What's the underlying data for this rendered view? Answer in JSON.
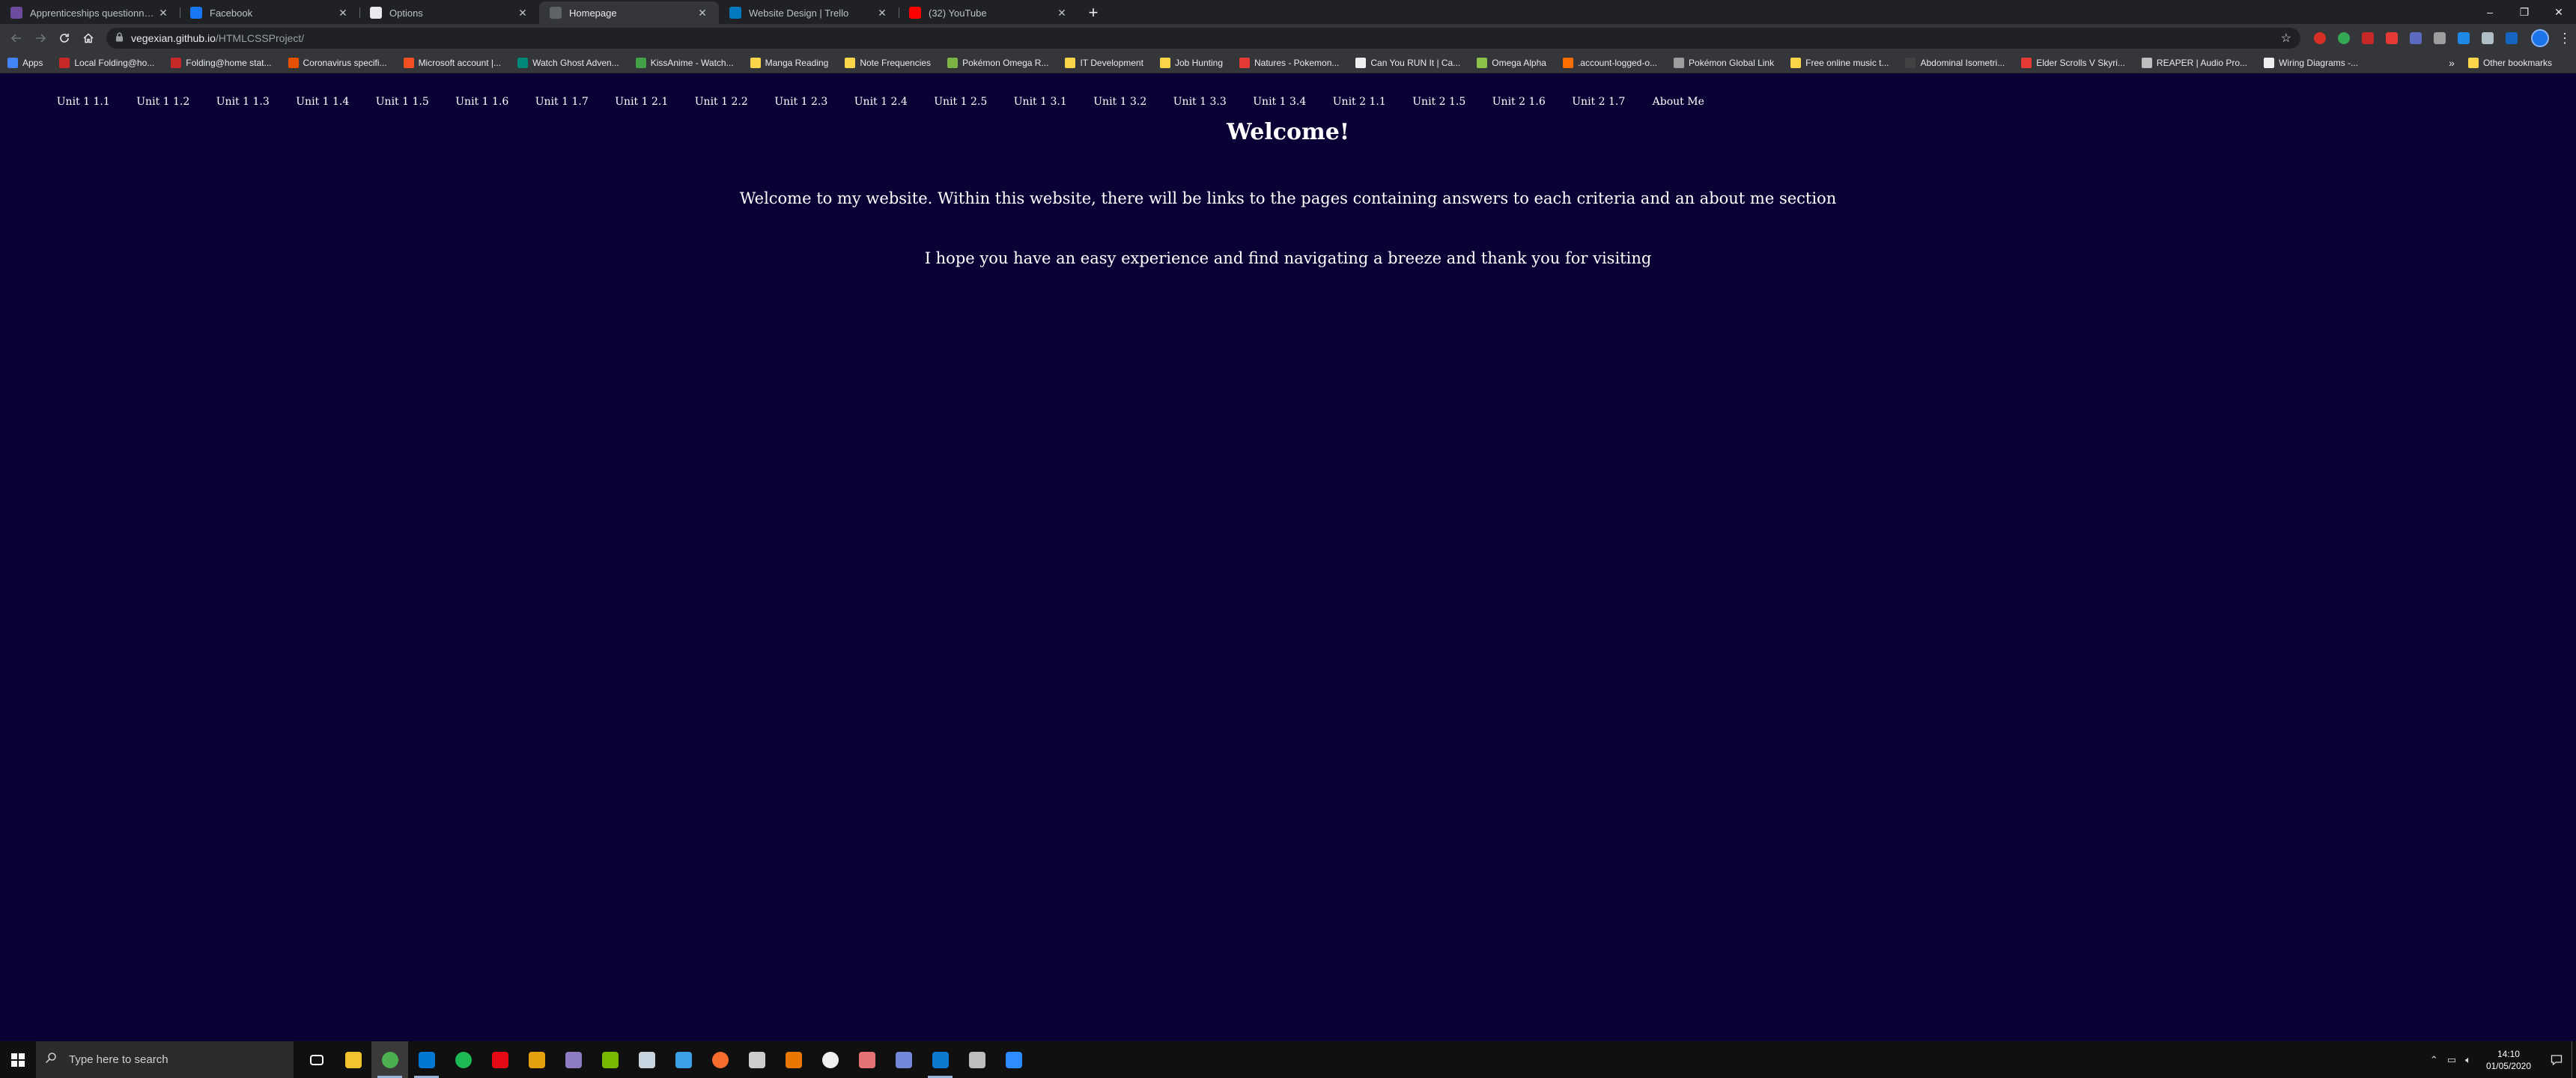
{
  "browser": {
    "tabs": [
      {
        "title": "Apprenticeships questionnaire",
        "icon": "forms-icon",
        "color": "#6d4c9f",
        "active": false
      },
      {
        "title": "Facebook",
        "icon": "facebook-icon",
        "color": "#1877f2",
        "active": false
      },
      {
        "title": "Options",
        "icon": "github-icon",
        "color": "#e8eaed",
        "active": false
      },
      {
        "title": "Homepage",
        "icon": "page-icon",
        "color": "#5f6368",
        "active": true
      },
      {
        "title": "Website Design | Trello",
        "icon": "trello-icon",
        "color": "#0079bf",
        "active": false
      },
      {
        "title": "(32) YouTube",
        "icon": "youtube-icon",
        "color": "#ff0000",
        "active": false
      }
    ],
    "new_tab_glyph": "+",
    "window_controls": {
      "minimize": "–",
      "restore": "❐",
      "close": "✕"
    },
    "url_host": "vegexian.github.io",
    "url_path": "/HTMLCSSProject/",
    "bookmarks": [
      {
        "label": "Apps",
        "color": "#4285f4"
      },
      {
        "label": "Local Folding@ho...",
        "color": "#c62828"
      },
      {
        "label": "Folding@home stat...",
        "color": "#c62828"
      },
      {
        "label": "Coronavirus specifi...",
        "color": "#e65100"
      },
      {
        "label": "Microsoft account |...",
        "color": "#f25022"
      },
      {
        "label": "Watch Ghost Adven...",
        "color": "#00897b"
      },
      {
        "label": "KissAnime - Watch...",
        "color": "#43a047"
      },
      {
        "label": "Manga Reading",
        "color": "#f9d549"
      },
      {
        "label": "Note Frequencies",
        "color": "#f9d549"
      },
      {
        "label": "Pokémon Omega R...",
        "color": "#7cb342"
      },
      {
        "label": "IT Development",
        "color": "#f9d549"
      },
      {
        "label": "Job Hunting",
        "color": "#f9d549"
      },
      {
        "label": "Natures - Pokemon...",
        "color": "#e53935"
      },
      {
        "label": "Can You RUN It | Ca...",
        "color": "#eeeeee"
      },
      {
        "label": "Omega Alpha",
        "color": "#8bc34a"
      },
      {
        "label": ".account-logged-o...",
        "color": "#ff6f00"
      },
      {
        "label": "Pokémon Global Link",
        "color": "#9e9e9e"
      },
      {
        "label": "Free online music t...",
        "color": "#f9d549"
      },
      {
        "label": "Abdominal Isometri...",
        "color": "#424242"
      },
      {
        "label": "Elder Scrolls V Skyri...",
        "color": "#e53935"
      },
      {
        "label": "REAPER | Audio Pro...",
        "color": "#bdbdbd"
      },
      {
        "label": "Wiring Diagrams -...",
        "color": "#eeeeee"
      }
    ],
    "bookmarks_more": "»",
    "other_bookmarks": "Other bookmarks"
  },
  "site": {
    "nav": [
      "Unit 1 1.1",
      "Unit 1 1.2",
      "Unit 1 1.3",
      "Unit 1 1.4",
      "Unit 1 1.5",
      "Unit 1 1.6",
      "Unit 1 1.7",
      "Unit 1 2.1",
      "Unit 1 2.2",
      "Unit 1 2.3",
      "Unit 1 2.4",
      "Unit 1 2.5",
      "Unit 1 3.1",
      "Unit 1 3.2",
      "Unit 1 3.3",
      "Unit 1 3.4",
      "Unit 2 1.1",
      "Unit 2 1.5",
      "Unit 2 1.6",
      "Unit 2 1.7",
      "About Me"
    ],
    "heading": "Welcome!",
    "paragraph1": "Welcome to my website. Within this website, there will be links to the pages containing answers to each criteria and an about me section",
    "paragraph2": "I hope you have an easy experience and find navigating a breeze and thank you for visiting",
    "background": "#0a0234"
  },
  "taskbar": {
    "search_placeholder": "Type here to search",
    "apps": [
      {
        "name": "task-view-icon",
        "color": "#ffffff"
      },
      {
        "name": "file-explorer-icon",
        "color": "#f4c430"
      },
      {
        "name": "chrome-icon",
        "color": "#4caf50"
      },
      {
        "name": "mail-icon",
        "color": "#0078d4"
      },
      {
        "name": "spotify-icon",
        "color": "#1db954"
      },
      {
        "name": "netflix-icon",
        "color": "#e50914"
      },
      {
        "name": "plex-icon",
        "color": "#e5a00d"
      },
      {
        "name": "app-purple-icon",
        "color": "#8e7cc3"
      },
      {
        "name": "nvidia-icon",
        "color": "#76b900"
      },
      {
        "name": "steam-icon",
        "color": "#c7d5e0"
      },
      {
        "name": "uplay-icon",
        "color": "#3ba0e6"
      },
      {
        "name": "origin-icon",
        "color": "#f56c2d"
      },
      {
        "name": "epic-icon",
        "color": "#cccccc"
      },
      {
        "name": "blender-icon",
        "color": "#ea7600"
      },
      {
        "name": "app-white-icon",
        "color": "#f0f0f0"
      },
      {
        "name": "paint-icon",
        "color": "#e57373"
      },
      {
        "name": "discord-icon",
        "color": "#7289da"
      },
      {
        "name": "vscode-icon",
        "color": "#0a7acc"
      },
      {
        "name": "gimp-icon",
        "color": "#bdbdbd"
      },
      {
        "name": "zoom-icon",
        "color": "#2d8cff"
      }
    ],
    "time": "14:10",
    "date": "01/05/2020"
  }
}
